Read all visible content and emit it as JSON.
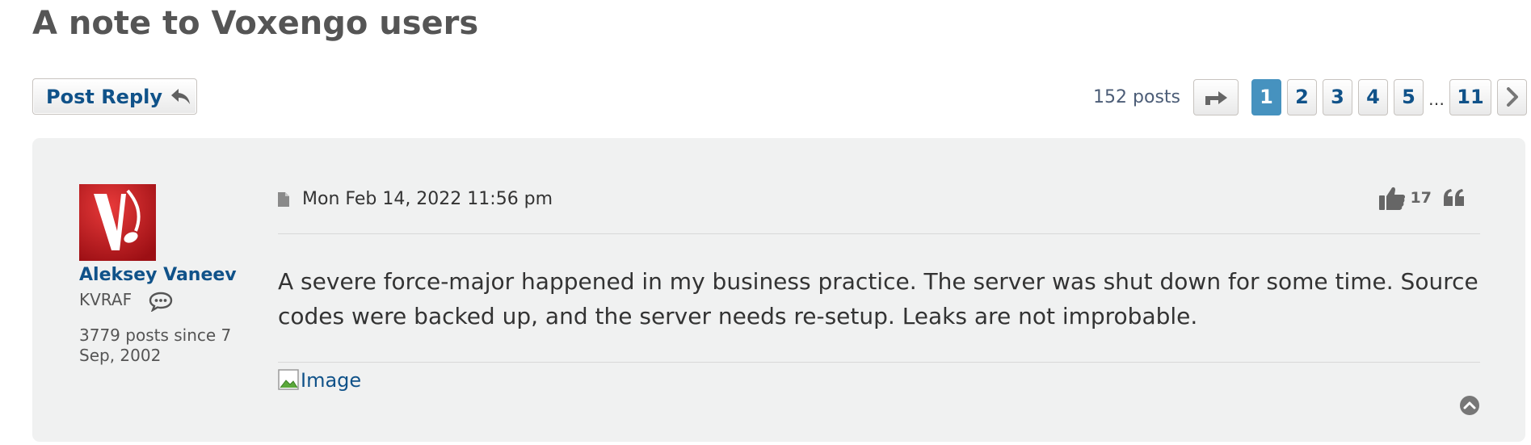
{
  "topic": {
    "title": "A note to Voxengo users"
  },
  "actions": {
    "post_reply_label": "Post Reply"
  },
  "pagination": {
    "post_count": "152 posts",
    "pages": [
      "1",
      "2",
      "3",
      "4",
      "5"
    ],
    "current_page": "1",
    "ellipsis": "…",
    "last_page": "11"
  },
  "post": {
    "author": "Aleksey Vaneev",
    "rank": "KVRAF",
    "user_stats": "3779 posts since 7 Sep, 2002",
    "date": "Mon Feb 14, 2022 11:56 pm",
    "like_count": "17",
    "content": "A severe force-major happened in my business practice. The server was shut down for some time. Source codes were backed up, and the server needs re-setup. Leaks are not improbable.",
    "image_alt": "Image"
  },
  "colors": {
    "link": "#105289",
    "current_page": "#4692bf",
    "post_bg": "#f0f1f1",
    "avatar_red": "#c41e1e"
  },
  "icons": {
    "reply": "reply-arrow-icon",
    "jump": "share-arrow-icon",
    "next": "chevron-right-icon",
    "post_doc": "document-icon",
    "like": "thumbs-up-icon",
    "quote": "quote-icon",
    "pm": "speech-bubble-icon",
    "top": "circle-chevron-up-icon"
  }
}
